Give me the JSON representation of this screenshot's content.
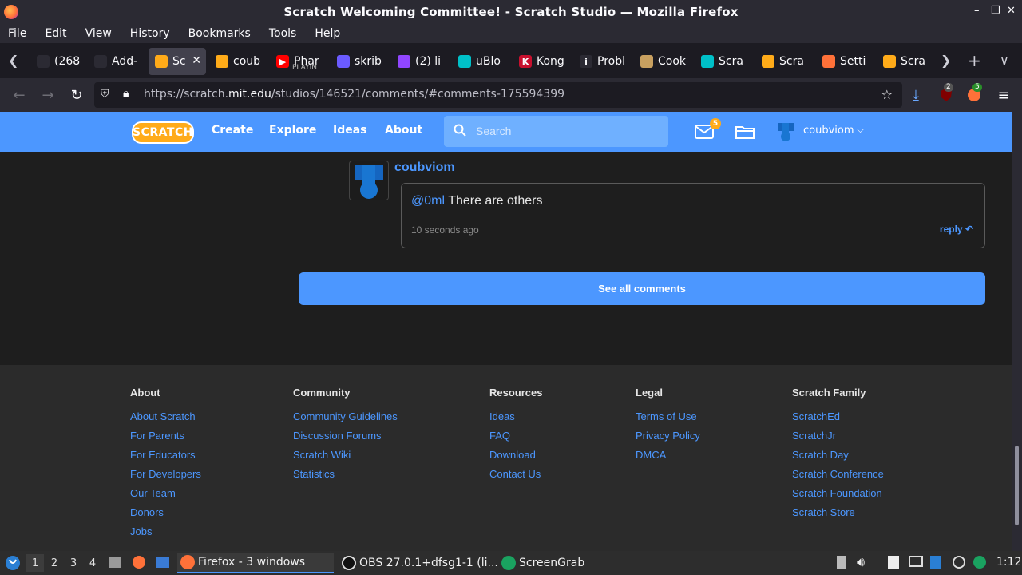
{
  "window": {
    "title": "Scratch Welcoming Committee! - Scratch Studio — Mozilla Firefox"
  },
  "menubar": [
    "File",
    "Edit",
    "View",
    "History",
    "Bookmarks",
    "Tools",
    "Help"
  ],
  "tabs": [
    {
      "label": "(268",
      "icon_color": "#2b2a33",
      "icon_text": ""
    },
    {
      "label": "Add-",
      "icon_color": "#2b2a33",
      "icon_text": ""
    },
    {
      "label": "Sc",
      "icon_color": "#ffab19",
      "icon_text": "",
      "active": true
    },
    {
      "label": "coub",
      "icon_color": "#ffab19",
      "icon_text": ""
    },
    {
      "label": "Phar",
      "sub": "PLAYIN",
      "icon_color": "#ff0000",
      "icon_text": "▶"
    },
    {
      "label": "skrib",
      "icon_color": "#6b5bff",
      "icon_text": ""
    },
    {
      "label": "(2) li",
      "icon_color": "#9146ff",
      "icon_text": ""
    },
    {
      "label": "uBlo",
      "icon_color": "#00c0c8",
      "icon_text": ""
    },
    {
      "label": "Kong",
      "icon_color": "#c8102e",
      "icon_text": "K"
    },
    {
      "label": "Probl",
      "icon_color": "#2b2a33",
      "icon_text": "i"
    },
    {
      "label": "Cook",
      "icon_color": "#c8a060",
      "icon_text": ""
    },
    {
      "label": "Scra",
      "icon_color": "#00c0c8",
      "icon_text": ""
    },
    {
      "label": "Scra",
      "icon_color": "#ffab19",
      "icon_text": ""
    },
    {
      "label": "Setti",
      "icon_color": "#ff7139",
      "icon_text": ""
    },
    {
      "label": "Scra",
      "icon_color": "#ffab19",
      "icon_text": ""
    }
  ],
  "navbar": {
    "url_prefix": "https://scratch.",
    "url_domain": "mit.edu",
    "url_suffix": "/studios/146521/comments/#comments-175594399",
    "ublock_badge": "2",
    "ext_badge": "5"
  },
  "scratch_nav": {
    "logo": "SCRATCH",
    "links": [
      "Create",
      "Explore",
      "Ideas",
      "About"
    ],
    "search_placeholder": "Search",
    "messages_count": "5",
    "username": "coubviom"
  },
  "comment": {
    "author": "coubviom",
    "mention": "@0ml",
    "text": " There are others",
    "time": "10 seconds ago",
    "reply_label": "reply"
  },
  "see_all_label": "See all comments",
  "footer": {
    "columns": [
      {
        "heading": "About",
        "links": [
          "About Scratch",
          "For Parents",
          "For Educators",
          "For Developers",
          "Our Team",
          "Donors",
          "Jobs"
        ]
      },
      {
        "heading": "Community",
        "links": [
          "Community Guidelines",
          "Discussion Forums",
          "Scratch Wiki",
          "Statistics"
        ]
      },
      {
        "heading": "Resources",
        "links": [
          "Ideas",
          "FAQ",
          "Download",
          "Contact Us"
        ]
      },
      {
        "heading": "Legal",
        "links": [
          "Terms of Use",
          "Privacy Policy",
          "DMCA"
        ]
      },
      {
        "heading": "Scratch Family",
        "links": [
          "ScratchEd",
          "ScratchJr",
          "Scratch Day",
          "Scratch Conference",
          "Scratch Foundation",
          "Scratch Store"
        ]
      }
    ]
  },
  "taskbar": {
    "workspaces": [
      "1",
      "2",
      "3",
      "4"
    ],
    "apps": [
      {
        "label": "Firefox - 3 windows",
        "active": true
      },
      {
        "label": "OBS 27.0.1+dfsg1-1 (li...",
        "active": false
      },
      {
        "label": "ScreenGrab",
        "active": false
      }
    ],
    "clock": "1:12"
  },
  "colors": {
    "scratch_blue": "#4c97ff",
    "scratch_orange": "#ffab19",
    "footer_bg": "#2b2b2b",
    "content_bg": "#1e1e1e"
  }
}
